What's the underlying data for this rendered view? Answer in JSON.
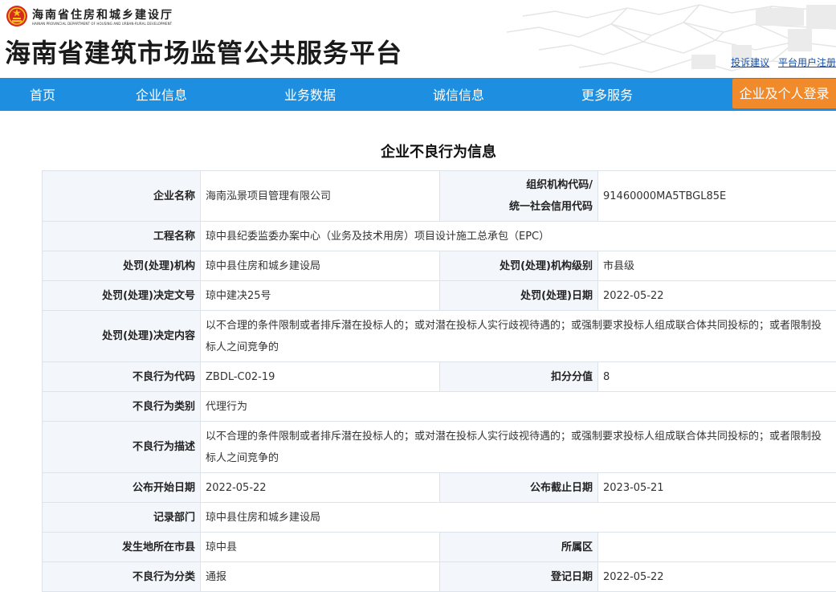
{
  "header": {
    "department_cn": "海南省住房和城乡建设厅",
    "department_en": "HAINAN PROVINCIAL DEPARTMENT OF HOUSING AND URBAN-RURAL DEVELOPMENT",
    "site_title": "海南省建筑市场监管公共服务平台",
    "links": {
      "complaint": "投诉建议",
      "register": "平台用户注册"
    }
  },
  "nav": {
    "items": [
      "首页",
      "企业信息",
      "业务数据",
      "诚信信息",
      "更多服务"
    ],
    "login": "企业及个人登录"
  },
  "colors": {
    "nav_bg": "#1e8fe0",
    "login_bg": "#f08a2b",
    "label_bg": "#f3f6fa"
  },
  "icons": {
    "emblem": "national-emblem-icon"
  },
  "page": {
    "heading": "企业不良行为信息"
  },
  "record": {
    "company_name": {
      "label": "企业名称",
      "value": "海南泓景项目管理有限公司"
    },
    "org_code": {
      "label_line1": "组织机构代码/",
      "label_line2": "统一社会信用代码",
      "value": "91460000MA5TBGL85E"
    },
    "project_name": {
      "label": "工程名称",
      "value": "琼中县纪委监委办案中心（业务及技术用房）项目设计施工总承包（EPC）"
    },
    "penalty_org": {
      "label": "处罚(处理)机构",
      "value": "琼中县住房和城乡建设局"
    },
    "penalty_org_level": {
      "label": "处罚(处理)机构级别",
      "value": "市县级"
    },
    "decision_no": {
      "label": "处罚(处理)决定文号",
      "value": "琼中建决25号"
    },
    "penalty_date": {
      "label": "处罚(处理)日期",
      "value": "2022-05-22"
    },
    "decision_content": {
      "label": "处罚(处理)决定内容",
      "value": "以不合理的条件限制或者排斥潜在投标人的；或对潜在投标人实行歧视待遇的；或强制要求投标人组成联合体共同投标的；或者限制投标人之间竞争的"
    },
    "behavior_code": {
      "label": "不良行为代码",
      "value": "ZBDL-C02-19"
    },
    "deduction": {
      "label": "扣分分值",
      "value": "8"
    },
    "behavior_category": {
      "label": "不良行为类别",
      "value": "代理行为"
    },
    "behavior_desc": {
      "label": "不良行为描述",
      "value": "以不合理的条件限制或者排斥潜在投标人的；或对潜在投标人实行歧视待遇的；或强制要求投标人组成联合体共同投标的；或者限制投标人之间竞争的"
    },
    "publish_start": {
      "label": "公布开始日期",
      "value": "2022-05-22"
    },
    "publish_end": {
      "label": "公布截止日期",
      "value": "2023-05-21"
    },
    "record_dept": {
      "label": "记录部门",
      "value": "琼中县住房和城乡建设局"
    },
    "city": {
      "label": "发生地所在市县",
      "value": "琼中县"
    },
    "district": {
      "label": "所属区",
      "value": ""
    },
    "behavior_class": {
      "label": "不良行为分类",
      "value": "通报"
    },
    "register_date": {
      "label": "登记日期",
      "value": "2022-05-22"
    }
  }
}
